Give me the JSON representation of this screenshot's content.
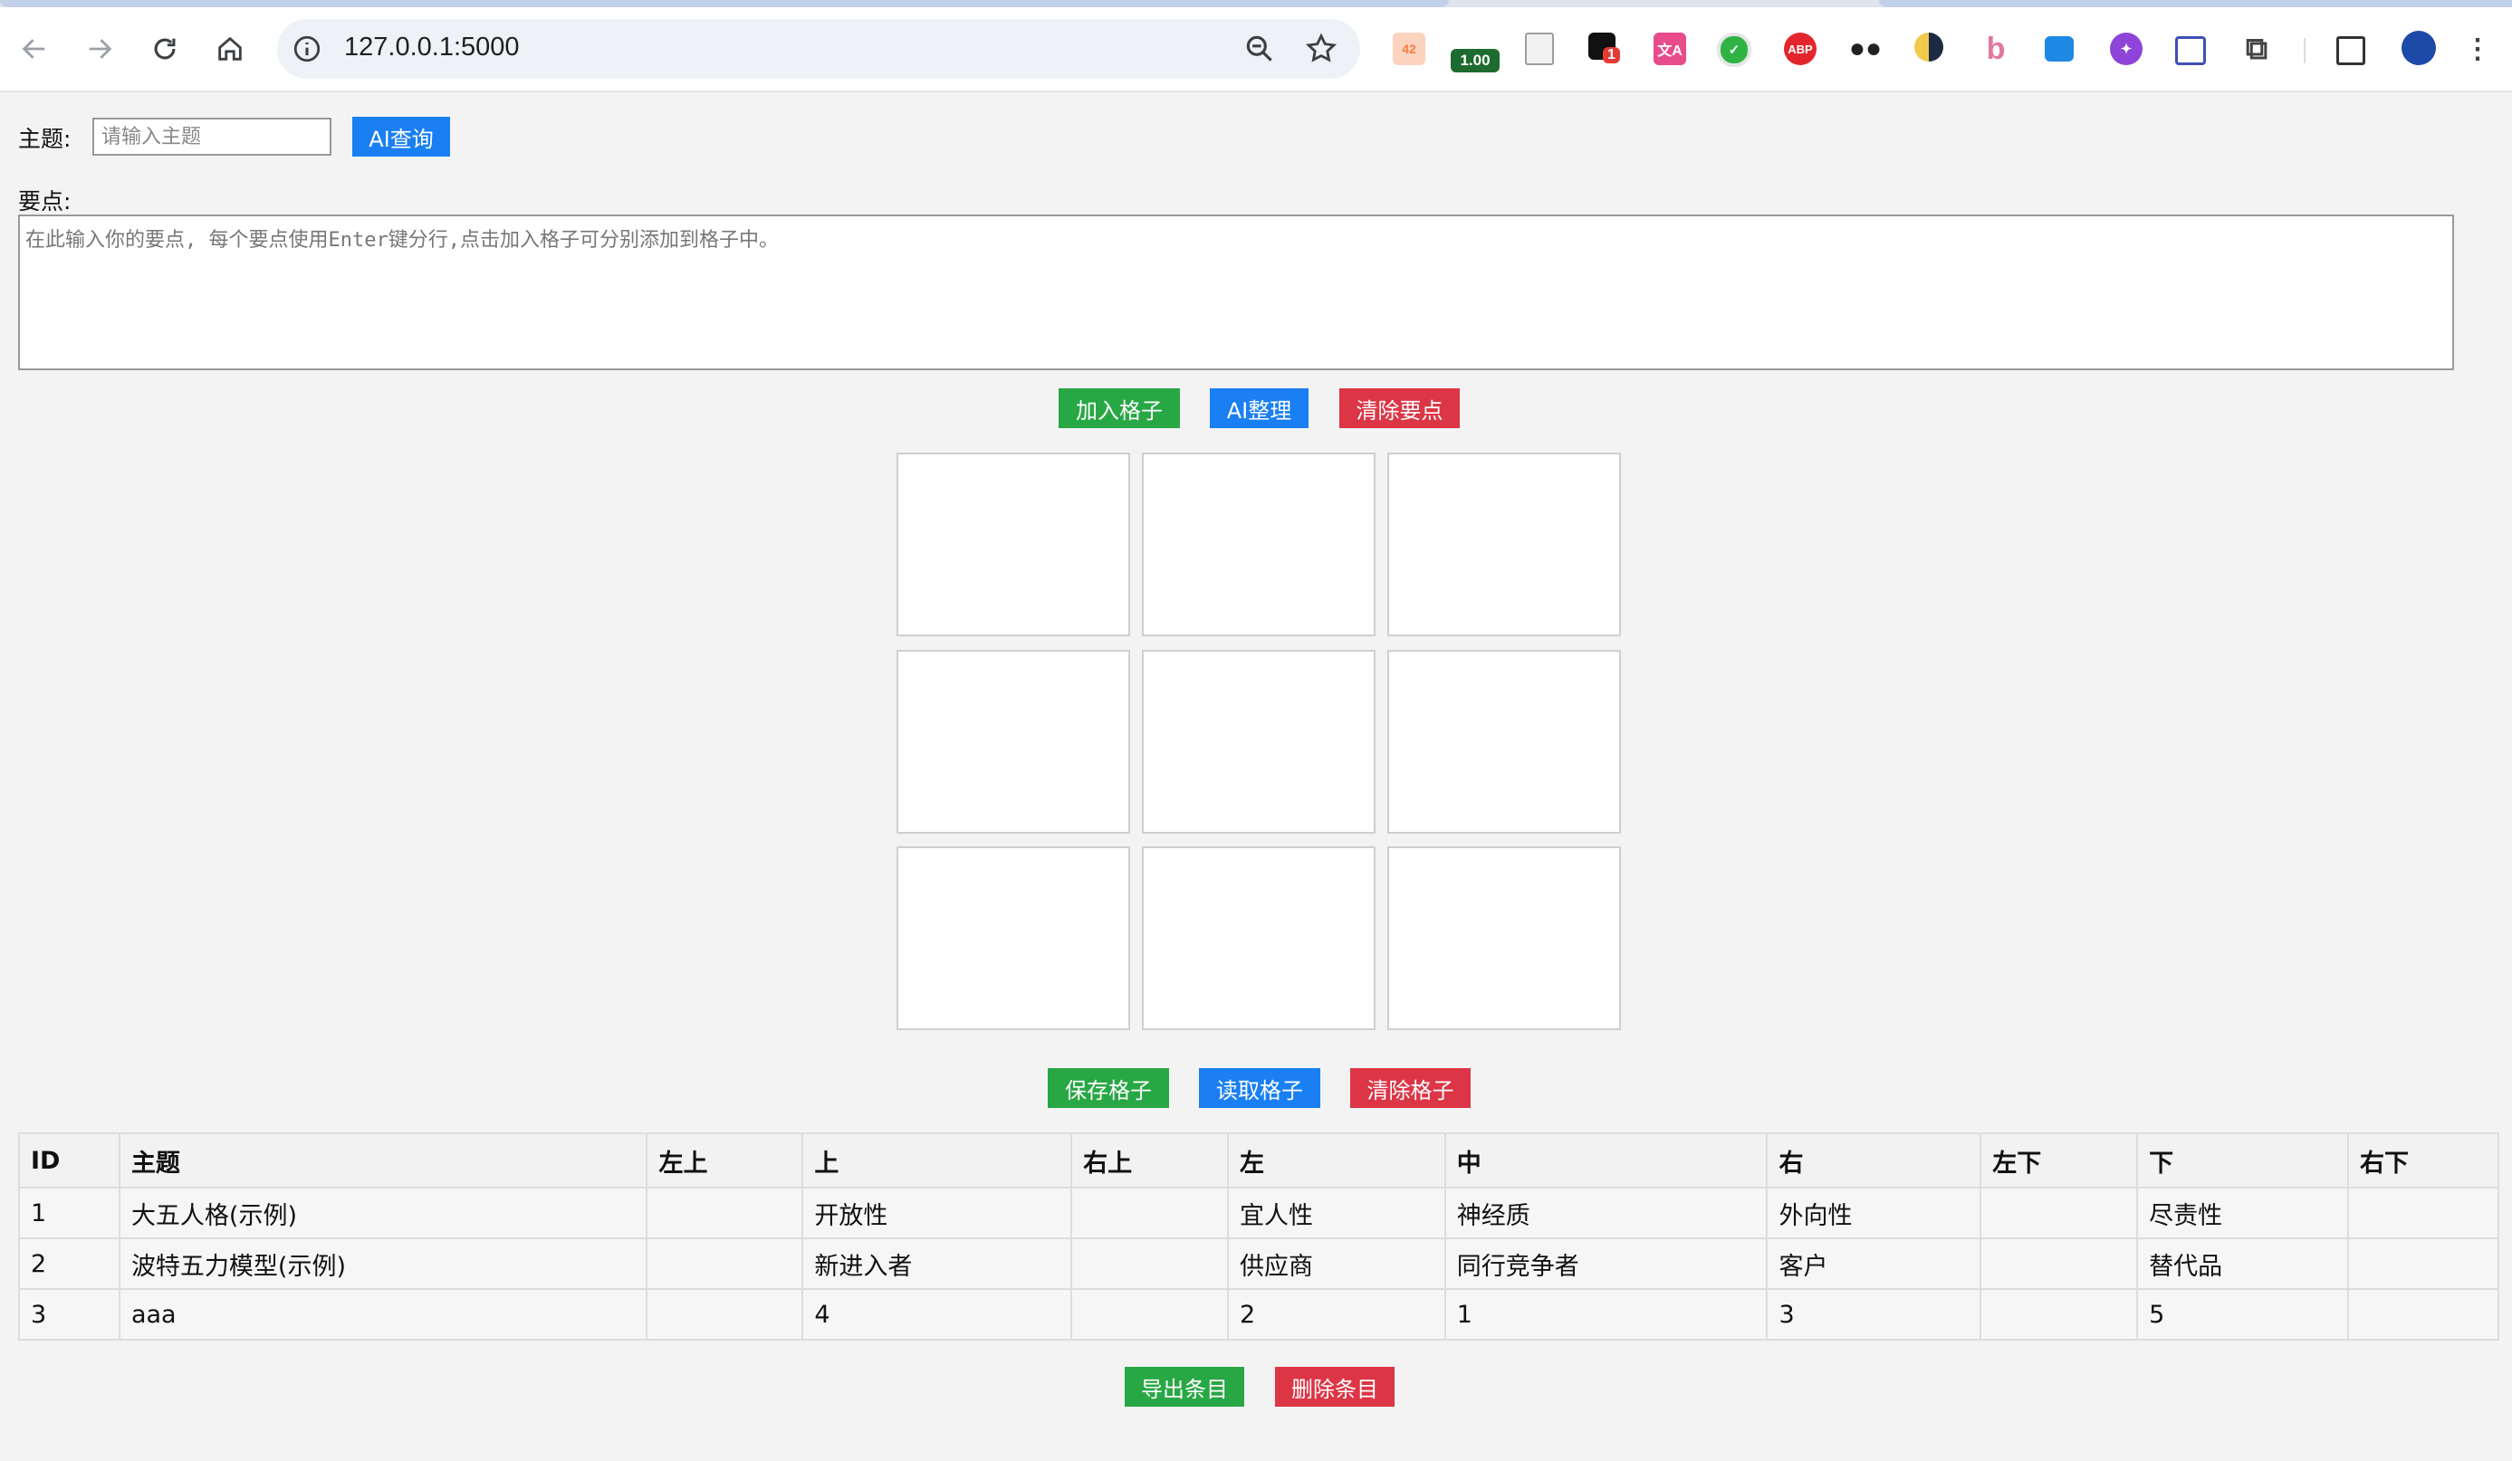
{
  "browser": {
    "url": "127.0.0.1:5000",
    "extensions": [
      {
        "icon": "translate-42-icon",
        "text": "42",
        "color": "#f7a27a"
      },
      {
        "icon": "speed-meter-icon",
        "text": "1.00",
        "color": "#1e6b2f"
      },
      {
        "icon": "document-icon",
        "text": "",
        "color": "#9e9e9e"
      },
      {
        "icon": "notification-extension-icon",
        "text": "1",
        "color": "#e53935"
      },
      {
        "icon": "translate-extension-icon",
        "text": "",
        "color": "#e84c8b"
      },
      {
        "icon": "v-extension-icon",
        "text": "",
        "color": "#2fb344"
      },
      {
        "icon": "adblock-plus-icon",
        "text": "ABP",
        "color": "#e3262e"
      },
      {
        "icon": "dots-extension-icon",
        "text": "",
        "color": "#333333"
      },
      {
        "icon": "dark-mode-icon",
        "text": "",
        "color": "#f2c94c"
      },
      {
        "icon": "bing-icon",
        "text": "",
        "color": "#e078a0"
      },
      {
        "icon": "screen-capture-icon",
        "text": "",
        "color": "#1e88e5"
      },
      {
        "icon": "magic-wand-icon",
        "text": "",
        "color": "#8e44d9"
      },
      {
        "icon": "window-extension-icon",
        "text": "",
        "color": "#3f51b5"
      },
      {
        "icon": "puzzle-extensions-icon",
        "text": "",
        "color": "#444444"
      }
    ]
  },
  "topic": {
    "label": "主题:",
    "placeholder": "请输入主题",
    "value": "",
    "ai_query_button": "AI查询"
  },
  "points": {
    "label": "要点:",
    "placeholder": "在此输入你的要点, 每个要点使用Enter键分行,点击加入格子可分别添加到格子中。"
  },
  "point_actions": {
    "add_to_grid": "加入格子",
    "ai_organize": "AI整理",
    "clear_points": "清除要点"
  },
  "grid": {
    "cells": [
      "",
      "",
      "",
      "",
      "",
      "",
      "",
      "",
      ""
    ]
  },
  "grid_actions": {
    "save": "保存格子",
    "load": "读取格子",
    "clear": "清除格子"
  },
  "table": {
    "headers": [
      "ID",
      "主题",
      "左上",
      "上",
      "右上",
      "左",
      "中",
      "右",
      "左下",
      "下",
      "右下"
    ],
    "rows": [
      [
        "1",
        "大五人格(示例)",
        "",
        "开放性",
        "",
        "宜人性",
        "神经质",
        "外向性",
        "",
        "尽责性",
        ""
      ],
      [
        "2",
        "波特五力模型(示例)",
        "",
        "新进入者",
        "",
        "供应商",
        "同行竞争者",
        "客户",
        "",
        "替代品",
        ""
      ],
      [
        "3",
        "aaa",
        "",
        "4",
        "",
        "2",
        "1",
        "3",
        "",
        "5",
        ""
      ]
    ]
  },
  "table_actions": {
    "export": "导出条目",
    "delete": "删除条目"
  },
  "colors": {
    "blue": "#1a7ff3",
    "green": "#28a745",
    "red": "#dc3545"
  }
}
